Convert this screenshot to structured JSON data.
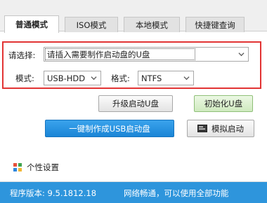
{
  "tabs": [
    {
      "label": "普通模式",
      "active": true
    },
    {
      "label": "ISO模式",
      "active": false
    },
    {
      "label": "本地模式",
      "active": false
    },
    {
      "label": "快捷键查询",
      "active": false
    }
  ],
  "device": {
    "label": "请选择:",
    "selected": "请插入需要制作启动盘的U盘"
  },
  "mode": {
    "label": "模式:",
    "selected": "USB-HDD"
  },
  "format": {
    "label": "格式:",
    "selected": "NTFS"
  },
  "buttons": {
    "upgrade": "升级启动U盘",
    "init": "初始化U盘",
    "make": "一键制作成USB启动盘",
    "simulate": "模拟启动"
  },
  "settings": {
    "label": "个性设置"
  },
  "status": {
    "version": "程序版本: 9.5.1812.18",
    "network": "网络畅通，可以使用全部功能"
  },
  "colors": {
    "accent": "#2e95dc",
    "highlight_border": "#e23434",
    "primary_button": "#1a85d6",
    "green_button": "#cfeabf"
  },
  "icons": {
    "dropdown": "chevron-down-icon",
    "simulate": "keyboard-icon",
    "settings": "grid-icon"
  }
}
